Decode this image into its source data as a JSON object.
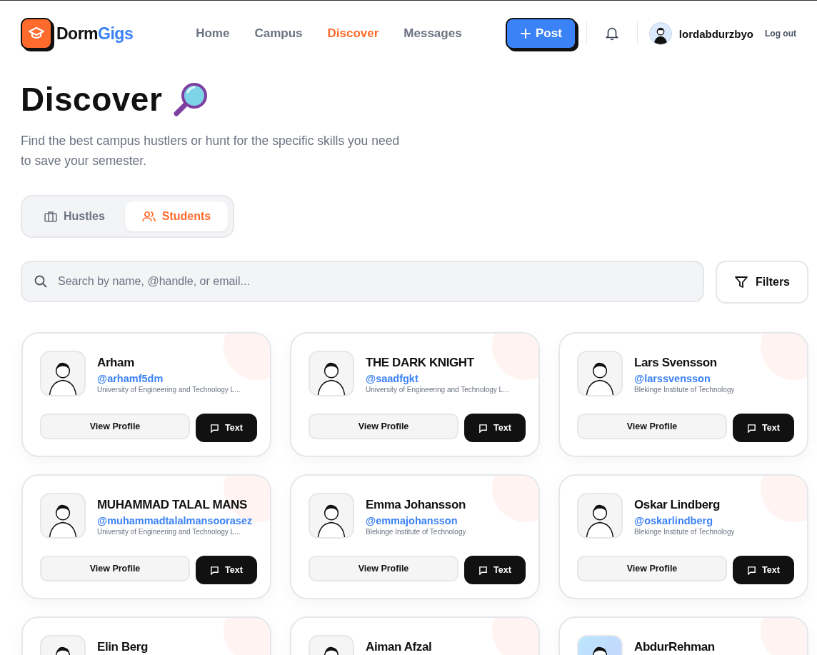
{
  "logo": {
    "part_1": "Dorm",
    "part_2": "Gigs"
  },
  "nav": [
    {
      "label": "Home",
      "selected": false
    },
    {
      "label": "Campus",
      "selected": false
    },
    {
      "label": "Discover",
      "selected": true
    },
    {
      "label": "Messages",
      "selected": false
    }
  ],
  "post_button": {
    "label": "Post"
  },
  "user": {
    "username": "lordabdurzbyo",
    "logout": "Log out"
  },
  "page": {
    "title": "Discover",
    "subtitle": "Find the best campus hustlers or hunt for the specific skills you need to save your semester."
  },
  "tabs": [
    {
      "label": "Hustles",
      "kind": "briefcase",
      "selected": false
    },
    {
      "label": "Students",
      "kind": "people",
      "selected": true
    }
  ],
  "search": {
    "placeholder": "Search by name, @handle, or email..."
  },
  "filters_button": {
    "label": "Filters"
  },
  "students": [
    {
      "name": "Arham",
      "handle": "@arhamf5dm",
      "university": "University of Engineering and Technology L...",
      "view_label": "View Profile",
      "text_label": "Text"
    },
    {
      "name": "THE DARK KNIGHT",
      "handle": "@saadfgkt",
      "university": "University of Engineering and Technology L...",
      "view_label": "View Profile",
      "text_label": "Text"
    },
    {
      "name": "Lars Svensson",
      "handle": "@larssvensson",
      "university": "Blekinge Institute of Technology",
      "view_label": "View Profile",
      "text_label": "Text"
    },
    {
      "name": "MUHAMMAD TALAL MANS",
      "handle": "@muhammadtalalmansoorasez",
      "university": "University of Engineering and Technology L...",
      "view_label": "View Profile",
      "text_label": "Text"
    },
    {
      "name": "Emma Johansson",
      "handle": "@emmajohansson",
      "university": "Blekinge Institute of Technology",
      "view_label": "View Profile",
      "text_label": "Text"
    },
    {
      "name": "Oskar Lindberg",
      "handle": "@oskarlindberg",
      "university": "Blekinge Institute of Technology",
      "view_label": "View Profile",
      "text_label": "Text"
    },
    {
      "name": "Elin Berg"
    },
    {
      "name": "Aiman Afzal"
    },
    {
      "name": "AbdurRehman"
    }
  ]
}
